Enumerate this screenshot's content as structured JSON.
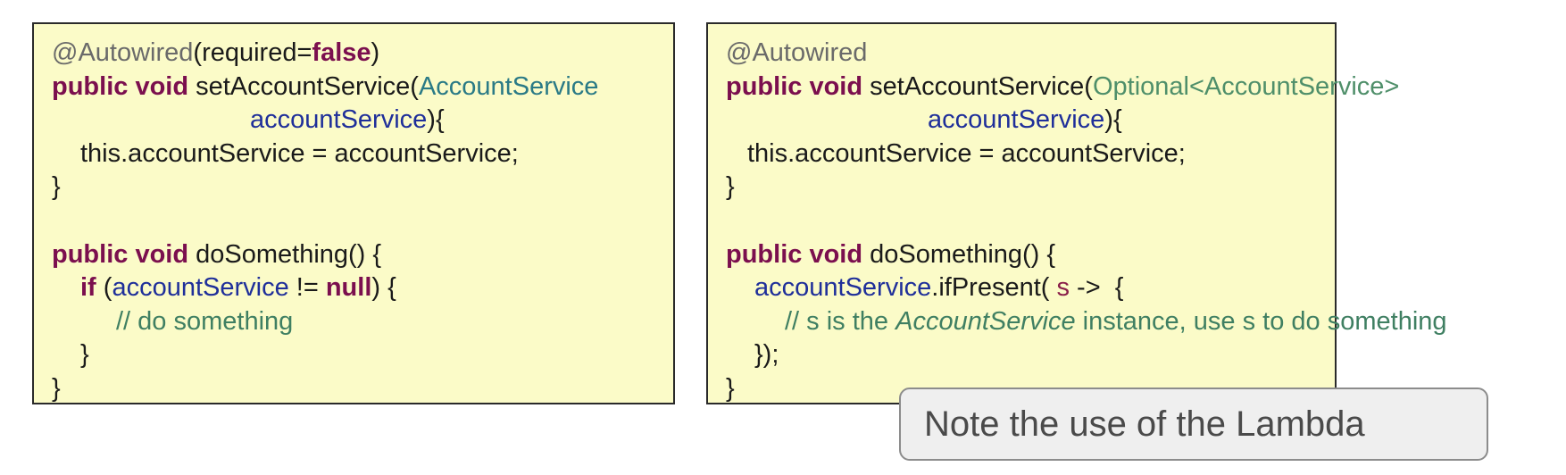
{
  "left_panel": {
    "lines": [
      [
        "@Autowired",
        "(required=",
        "false",
        ")"
      ],
      [
        "public void",
        " setAccountService(",
        "AccountService"
      ],
      [
        "accountService",
        "){"
      ],
      [
        "this.accountService = accountService;"
      ],
      [
        "}"
      ],
      [
        ""
      ],
      [
        "public void",
        " doSomething() {"
      ],
      [
        "if",
        " (",
        "accountService",
        " != ",
        "null",
        ") {"
      ],
      [
        "// do something"
      ],
      [
        "}"
      ],
      [
        "}"
      ]
    ]
  },
  "right_panel": {
    "lines": [
      [
        "@Autowired"
      ],
      [
        "public void",
        " setAccountService(",
        "Optional<AccountService>"
      ],
      [
        "accountService",
        "){"
      ],
      [
        "this.accountService = accountService;"
      ],
      [
        "}"
      ],
      [
        ""
      ],
      [
        "public void",
        " doSomething() {"
      ],
      [
        "accountService",
        ".ifPresent( ",
        "s",
        " -> ",
        " {"
      ],
      [
        "// s is the ",
        "AccountService",
        " instance, use s to do something"
      ],
      [
        "});"
      ],
      [
        "}"
      ]
    ]
  },
  "note": {
    "text": "Note the use of the Lambda"
  },
  "colors": {
    "panel_bg": "#fbfbc8",
    "keyword": "#7b0f4e",
    "type": "#2a7a86",
    "variable": "#1f2f9a",
    "comment": "#3f7f62",
    "annotation": "#6a6a6a"
  }
}
